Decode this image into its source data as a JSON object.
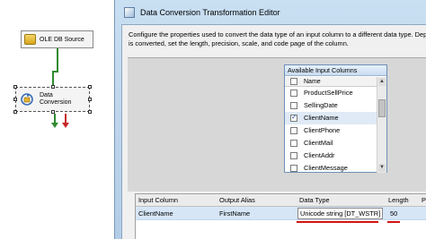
{
  "canvas": {
    "source_component": {
      "label": "OLE DB Source",
      "icon": "ole-db-source-icon"
    },
    "conversion_component": {
      "label_line1": "Data",
      "label_line2": "Conversion",
      "icon": "data-conversion-icon"
    },
    "colors": {
      "success_path": "#2f8a2f",
      "error_path": "#c62828"
    }
  },
  "window": {
    "title": "Data Conversion Transformation Editor",
    "description_line1": "Configure the properties used to convert the data type of an input column to a different data type. Dependi",
    "description_line2": "is converted, set the length, precision, scale, and code page of the column."
  },
  "available_columns": {
    "title": "Available Input Columns",
    "header": "Name",
    "items": [
      {
        "name": "ProductSellPrice",
        "checked": false
      },
      {
        "name": "SellingDate",
        "checked": false
      },
      {
        "name": "ClientName",
        "checked": true
      },
      {
        "name": "ClientPhone",
        "checked": false
      },
      {
        "name": "ClientMail",
        "checked": false
      },
      {
        "name": "ClientAddr",
        "checked": false
      },
      {
        "name": "ClientMessage",
        "checked": false
      }
    ]
  },
  "grid": {
    "headers": [
      "Input Column",
      "Output Alias",
      "Data Type",
      "Length",
      "P"
    ],
    "rows": [
      {
        "input_column": "ClientName",
        "output_alias": "FirstName",
        "data_type": "Unicode string [DT_WSTR]",
        "length": "50"
      }
    ],
    "highlight_color": "#d11313"
  }
}
